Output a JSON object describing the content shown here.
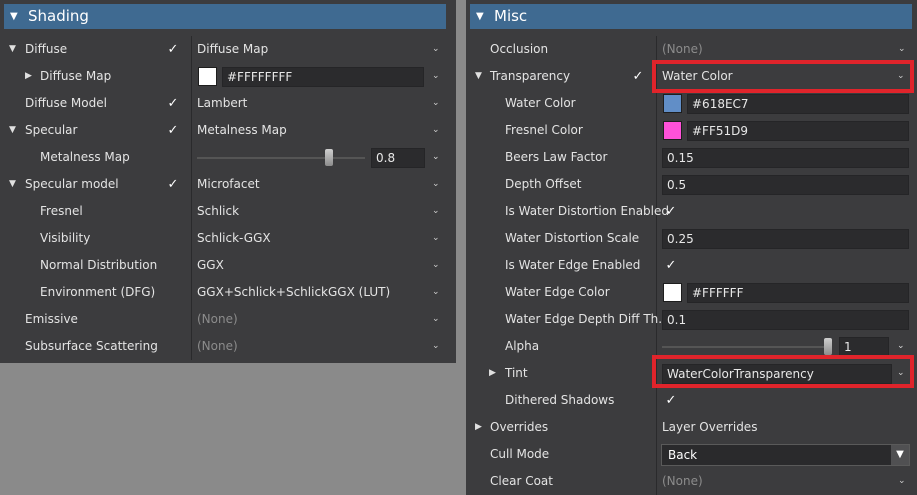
{
  "shading": {
    "title": "Shading",
    "rows": {
      "diffuse": {
        "label": "Diffuse",
        "value": "Diffuse Map"
      },
      "diffuse_map": {
        "label": "Diffuse Map",
        "value": "#FFFFFFFF",
        "color": "#FFFFFF"
      },
      "diffuse_model": {
        "label": "Diffuse Model",
        "value": "Lambert"
      },
      "specular": {
        "label": "Specular",
        "value": "Metalness Map"
      },
      "metalness_map": {
        "label": "Metalness Map",
        "value": "0.8",
        "slider_level": 0.8
      },
      "specular_model": {
        "label": "Specular model",
        "value": "Microfacet"
      },
      "fresnel": {
        "label": "Fresnel",
        "value": "Schlick"
      },
      "visibility": {
        "label": "Visibility",
        "value": "Schlick-GGX"
      },
      "normal_distribution": {
        "label": "Normal Distribution",
        "value": "GGX"
      },
      "environment": {
        "label": "Environment (DFG)",
        "value": "GGX+Schlick+SchlickGGX (LUT)"
      },
      "emissive": {
        "label": "Emissive",
        "value": "(None)"
      },
      "subsurface": {
        "label": "Subsurface Scattering",
        "value": "(None)"
      }
    }
  },
  "misc": {
    "title": "Misc",
    "rows": {
      "occlusion": {
        "label": "Occlusion",
        "value": "(None)"
      },
      "transparency": {
        "label": "Transparency",
        "value": "Water Color"
      },
      "water_color": {
        "label": "Water Color",
        "value": "#618EC7",
        "color": "#618EC7"
      },
      "fresnel_color": {
        "label": "Fresnel Color",
        "value": "#FF51D9",
        "color": "#FF51D9"
      },
      "beers_law": {
        "label": "Beers Law Factor",
        "value": "0.15"
      },
      "depth_offset": {
        "label": "Depth Offset",
        "value": "0.5"
      },
      "water_distortion_enabled": {
        "label": "Is Water Distortion Enabled"
      },
      "water_distortion_scale": {
        "label": "Water Distortion Scale",
        "value": "0.25"
      },
      "water_edge_enabled": {
        "label": "Is Water Edge Enabled"
      },
      "water_edge_color": {
        "label": "Water Edge Color",
        "value": "#FFFFFF",
        "color": "#FFFFFF"
      },
      "water_edge_depth": {
        "label": "Water Edge Depth Diff Th...",
        "value": "0.1"
      },
      "alpha": {
        "label": "Alpha",
        "value": "1",
        "slider_level": 1
      },
      "tint": {
        "label": "Tint",
        "value": "WaterColorTransparency"
      },
      "dithered_shadows": {
        "label": "Dithered Shadows"
      },
      "overrides": {
        "label": "Overrides",
        "value": "Layer Overrides"
      },
      "cull_mode": {
        "label": "Cull Mode",
        "value": "Back"
      },
      "clear_coat": {
        "label": "Clear Coat",
        "value": "(None)"
      }
    }
  },
  "glyphs": {
    "check": "✓",
    "expanded": "▼",
    "collapsed": "▶",
    "caret": "⌄",
    "combo_caret": "▼"
  },
  "colors": {
    "header": "#3f6a91",
    "highlight": "#e0242b",
    "panel": "#3c3c3e"
  }
}
